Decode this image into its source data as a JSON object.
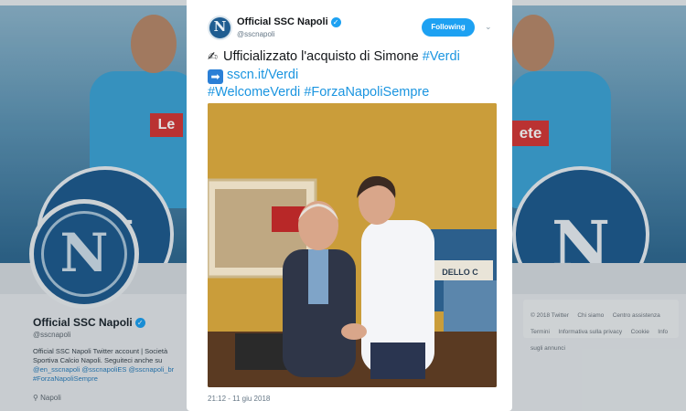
{
  "background_profile": {
    "name": "Official SSC Napoli",
    "handle": "@sscnapoli",
    "bio_text": "Official SSC Napoli Twitter account | Società Sportiva Calcio Napoli. Seguiteci anche su",
    "bio_links": "@en_sscnapoli @sscnapoliES @sscnapoli_br #ForzaNapoliSempre",
    "location": "Napoli",
    "banner_logo_letter": "N",
    "avatar_letter": "N",
    "shirt_text_left": "Le",
    "shirt_text_right": "ete",
    "footer_links": [
      "© 2018 Twitter",
      "Chi siamo",
      "Centro assistenza",
      "Termini",
      "Informativa sulla privacy",
      "Cookie",
      "Info sugli annunci"
    ]
  },
  "tweet": {
    "author_name": "Official SSC Napoli",
    "author_handle": "@sscnapoli",
    "avatar_letter": "N",
    "follow_label": "Following",
    "line1_text": "Ufficializzato l'acquisto di Simone ",
    "line1_tag": "#Verdi",
    "line2_link": "sscn.it/Verdi",
    "line3_tag1": "#WelcomeVerdi",
    "line3_tag2": "#ForzaNapoliSempre",
    "timestamp": "21:12 - 11 giu 2018",
    "photo_sign_text": "DELLO C"
  },
  "icons": {
    "verified": "verified-badge-icon",
    "chevron": "chevron-down-icon",
    "location": "location-pin-icon",
    "writing_hand": "writing-hand-emoji",
    "arrow": "right-arrow-emoji"
  },
  "colors": {
    "accent": "#1da1f2",
    "link": "#1b95e0",
    "text": "#14171a",
    "muted": "#657786",
    "napoli_blue": "#1f5d91"
  }
}
